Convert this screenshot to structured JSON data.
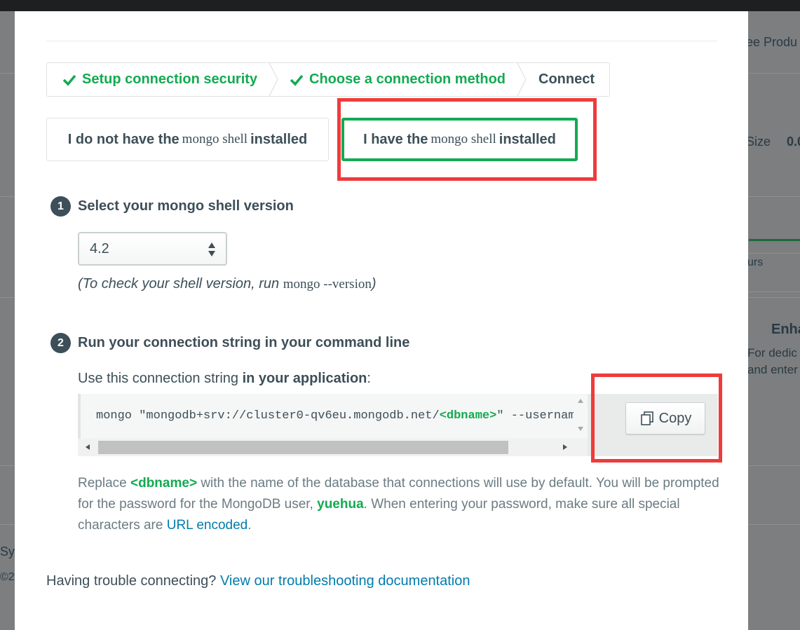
{
  "background": {
    "see_products": "ee Produ",
    "size_label": "Size",
    "size_value": "0.0",
    "hours_label": "urs",
    "enhance_title": "Enha",
    "enhance_line1": "For dedic",
    "enhance_line2": "and enter",
    "footer_sys": "Sy",
    "footer_copy": "©2"
  },
  "steps": [
    {
      "label": "Setup connection security",
      "status": "done"
    },
    {
      "label": "Choose a connection method",
      "status": "done"
    },
    {
      "label": "Connect",
      "status": "current"
    }
  ],
  "options": {
    "not_installed": {
      "prefix": "I do not have the",
      "mono": "mongo shell",
      "suffix": "installed"
    },
    "installed": {
      "prefix": "I have the",
      "mono": "mongo shell",
      "suffix": "installed"
    }
  },
  "section1": {
    "number": "1",
    "title": "Select your mongo shell version",
    "version_value": "4.2",
    "hint_prefix": "(To check your shell version, run",
    "hint_mono": "mongo --version",
    "hint_suffix": ")"
  },
  "section2": {
    "number": "2",
    "title": "Run your connection string in your command line",
    "use_prefix": "Use this connection string",
    "use_bold": "in your application",
    "use_suffix": ":",
    "code_prefix": "mongo \"mongodb+srv://cluster0-qv6eu.mongodb.net/",
    "code_highlight": "<dbname>",
    "code_suffix": "\" --username",
    "copy_label": "Copy",
    "replace_word": "Replace",
    "replace_tag": "<dbname>",
    "replace_text1": "with the name of the database that connections will use by default. You will be prompted for the password for the MongoDB user,",
    "replace_user": "yuehua",
    "replace_text2": ". When entering your password, make sure all special characters are",
    "replace_link": "URL encoded",
    "replace_end": "."
  },
  "trouble": {
    "prefix": "Having trouble connecting?",
    "link": "View our troubleshooting documentation"
  },
  "colors": {
    "accent_green": "#13aa52",
    "highlight_red": "#ef3b3b",
    "link_blue": "#007cad",
    "text_dark": "#3d4f58"
  }
}
